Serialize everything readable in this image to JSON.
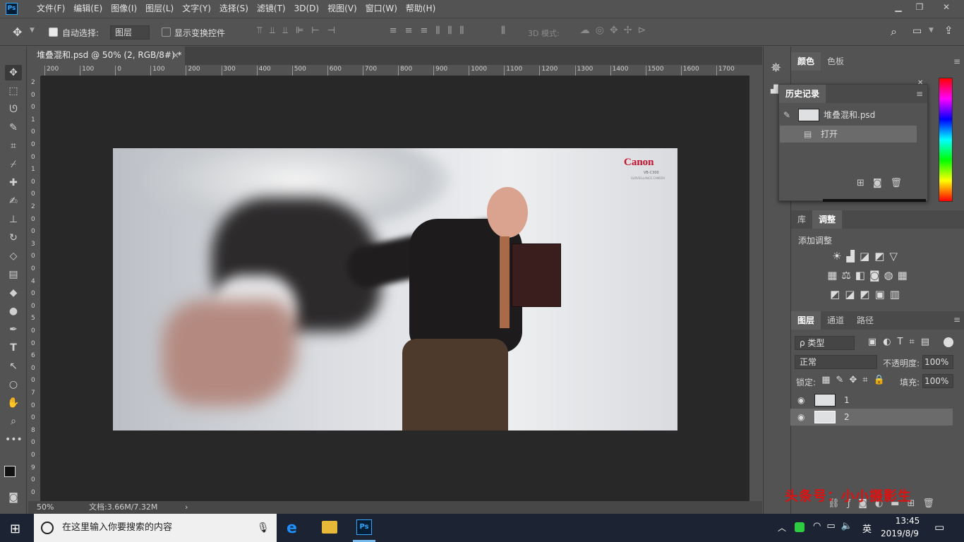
{
  "app": {
    "logo": "Ps"
  },
  "menu": [
    "文件(F)",
    "编辑(E)",
    "图像(I)",
    "图层(L)",
    "文字(Y)",
    "选择(S)",
    "滤镜(T)",
    "3D(D)",
    "视图(V)",
    "窗口(W)",
    "帮助(H)"
  ],
  "options": {
    "auto_select_label": "自动选择:",
    "auto_select_target": "图层",
    "transform_label": "显示变换控件",
    "mode3d_label": "3D 模式:"
  },
  "document": {
    "tab_title": "堆叠混和.psd @ 50% (2, RGB/8#) *",
    "close": "×"
  },
  "ruler_top": [
    "200",
    "100",
    "0",
    "100",
    "200",
    "300",
    "400",
    "500",
    "600",
    "700",
    "800",
    "900",
    "1000",
    "1100",
    "1200",
    "1300",
    "1400",
    "1500",
    "1600",
    "1700"
  ],
  "ruler_left": [
    "2",
    "0",
    "0",
    "1",
    "0",
    "0",
    "0",
    "1",
    "0",
    "0",
    "2",
    "0",
    "0",
    "3",
    "0",
    "0",
    "4",
    "0",
    "0",
    "5",
    "0",
    "0",
    "6",
    "0",
    "0",
    "7",
    "0",
    "0",
    "8",
    "0",
    "0",
    "9",
    "0",
    "0"
  ],
  "artwork": {
    "brand": "Canon",
    "model": "VB-C300",
    "tagline": "SURVEILLANCE CAMERA"
  },
  "status": {
    "zoom": "50%",
    "doc": "文档:3.66M/7.32M",
    "arrow": "›"
  },
  "color_panel": {
    "tabs": [
      "颜色",
      "色板"
    ]
  },
  "history_panel": {
    "title": "历史记录",
    "snapshot": "堆叠混和.psd",
    "step": "打开"
  },
  "adjust_panel": {
    "tabs": [
      "库",
      "调整"
    ],
    "heading": "添加调整"
  },
  "layers_panel": {
    "tabs": [
      "图层",
      "通道",
      "路径"
    ],
    "filter": "ρ 类型",
    "blend": "正常",
    "opacity_label": "不透明度:",
    "opacity": "100%",
    "lock_label": "锁定:",
    "fill_label": "填充:",
    "fill": "100%",
    "layers": [
      {
        "name": "1"
      },
      {
        "name": "2"
      }
    ]
  },
  "watermark": "头条号：小小摄影生",
  "taskbar": {
    "search_placeholder": "在这里输入你要搜索的内容",
    "lang": "英",
    "time": "13:45",
    "date": "2019/8/9"
  }
}
